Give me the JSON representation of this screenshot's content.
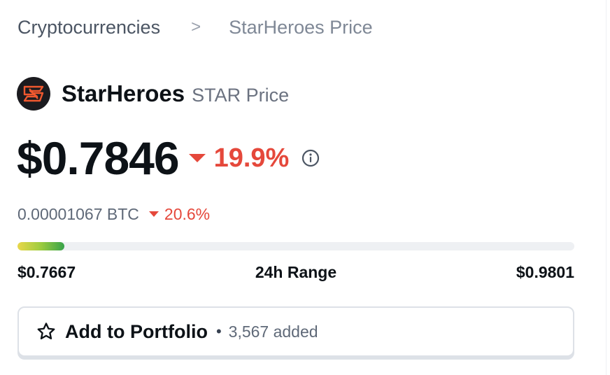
{
  "breadcrumb": {
    "parent": "Cryptocurrencies",
    "separator": ">",
    "current": "StarHeroes Price"
  },
  "coin": {
    "name": "StarHeroes",
    "symbol_label": "STAR Price",
    "logo_icon": "starheroes-logo-icon"
  },
  "price": {
    "usd": "$0.7846",
    "change_24h": "19.9%",
    "direction": "down",
    "btc": "0.00001067 BTC",
    "btc_change": "20.6%"
  },
  "range_24h": {
    "low": "$0.7667",
    "title": "24h Range",
    "high": "$0.9801",
    "position_fraction": 0.084
  },
  "portfolio": {
    "label": "Add to Portfolio",
    "separator": "•",
    "added": "3,567 added",
    "icon": "star-outline-icon"
  },
  "colors": {
    "negative": "#e5483b",
    "text_primary": "#0d1217",
    "text_secondary": "#5f6978",
    "track": "#eef0f3",
    "fill_start": "#e9d74a",
    "fill_end": "#37a24a"
  }
}
